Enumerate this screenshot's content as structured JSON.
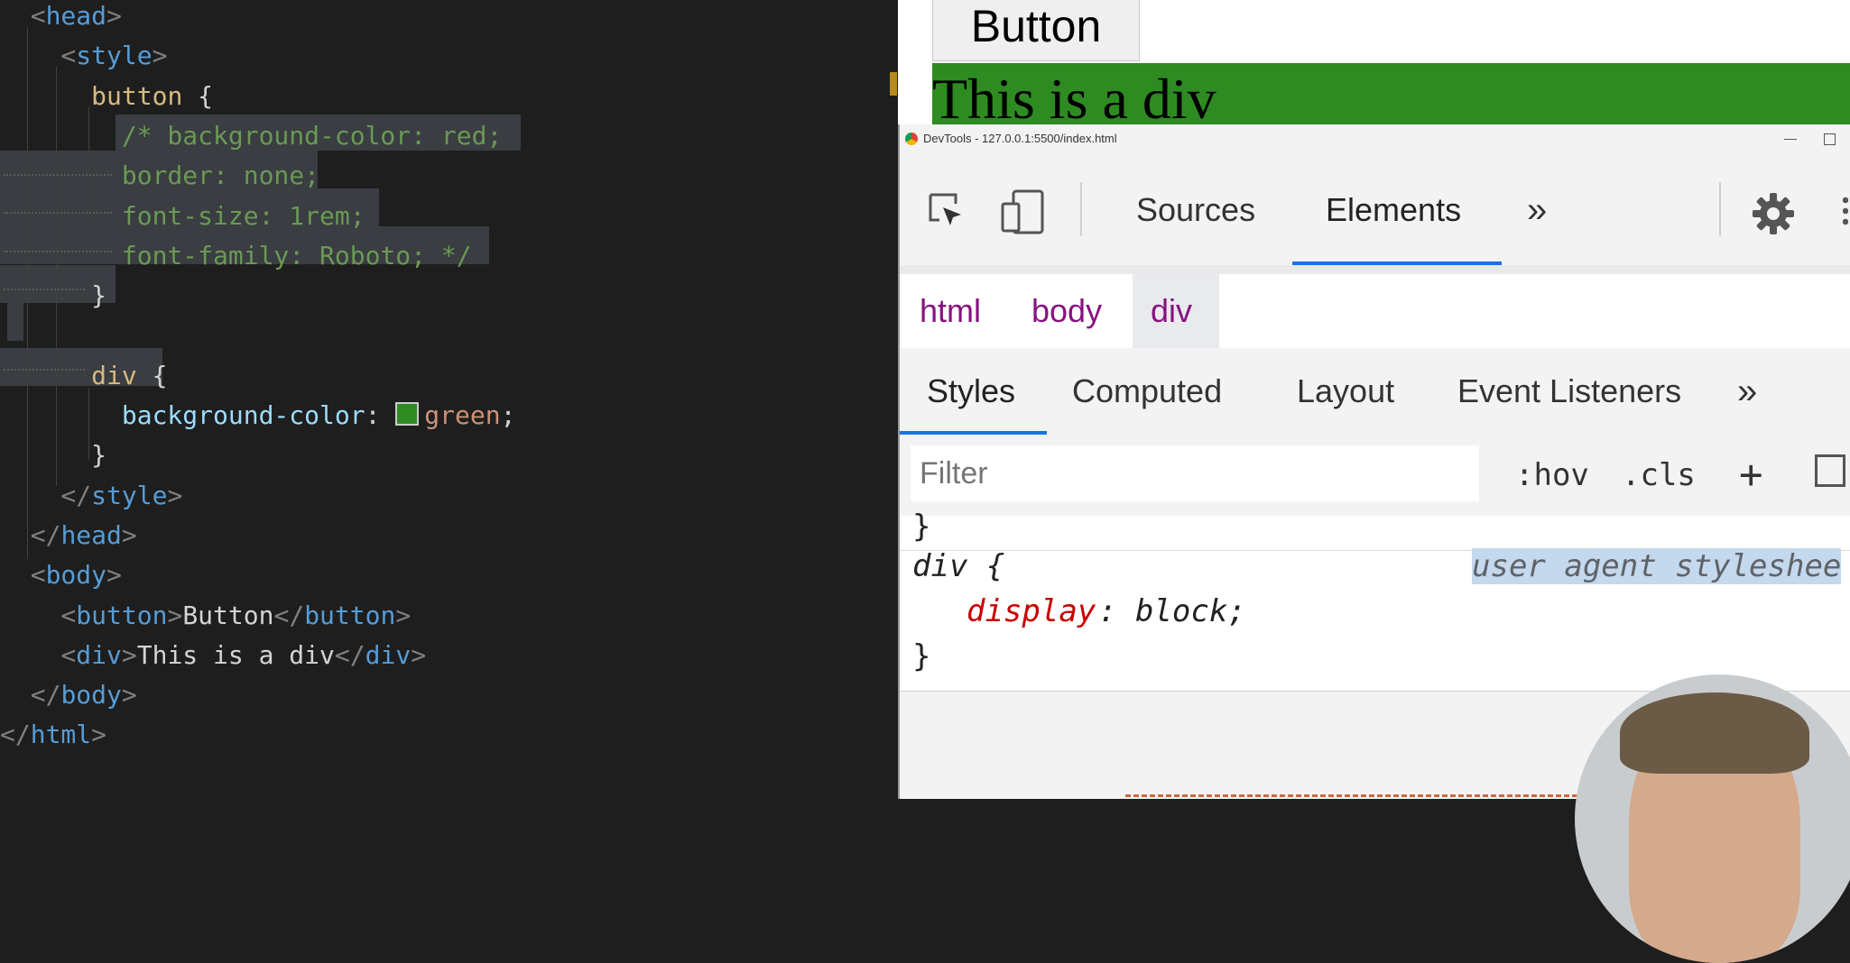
{
  "editor": {
    "lines": [
      [
        {
          "t": "  <",
          "c": "t-br"
        },
        {
          "t": "head",
          "c": "t-tag"
        },
        {
          "t": ">",
          "c": "t-br"
        }
      ],
      [
        {
          "t": "    <",
          "c": "t-br"
        },
        {
          "t": "style",
          "c": "t-tag"
        },
        {
          "t": ">",
          "c": "t-br"
        }
      ],
      [
        {
          "t": "      ",
          "c": "t-txt"
        },
        {
          "t": "button",
          "c": "t-sel"
        },
        {
          "t": " {",
          "c": "t-txt"
        }
      ],
      [
        {
          "t": "        /* background-color: red;",
          "c": "t-cm"
        }
      ],
      [
        {
          "t": "        border: none;",
          "c": "t-cm"
        }
      ],
      [
        {
          "t": "        font-size: 1rem;",
          "c": "t-cm"
        }
      ],
      [
        {
          "t": "        font-family: Roboto; */",
          "c": "t-cm"
        }
      ],
      [
        {
          "t": "      }",
          "c": "t-txt"
        }
      ],
      [
        {
          "t": "",
          "c": "t-txt"
        }
      ],
      [
        {
          "t": "      ",
          "c": "t-txt"
        },
        {
          "t": "div",
          "c": "t-sel"
        },
        {
          "t": " {",
          "c": "t-txt"
        }
      ],
      [
        {
          "t": "        ",
          "c": "t-txt"
        },
        {
          "t": "background-color",
          "c": "t-prop"
        },
        {
          "t": ": ",
          "c": "t-txt"
        },
        {
          "t": "",
          "c": "swatch"
        },
        {
          "t": "green",
          "c": "t-val"
        },
        {
          "t": ";",
          "c": "t-txt"
        }
      ],
      [
        {
          "t": "      }",
          "c": "t-txt"
        }
      ],
      [
        {
          "t": "    </",
          "c": "t-br"
        },
        {
          "t": "style",
          "c": "t-tag"
        },
        {
          "t": ">",
          "c": "t-br"
        }
      ],
      [
        {
          "t": "  </",
          "c": "t-br"
        },
        {
          "t": "head",
          "c": "t-tag"
        },
        {
          "t": ">",
          "c": "t-br"
        }
      ],
      [
        {
          "t": "  <",
          "c": "t-br"
        },
        {
          "t": "body",
          "c": "t-tag"
        },
        {
          "t": ">",
          "c": "t-br"
        }
      ],
      [
        {
          "t": "    <",
          "c": "t-br"
        },
        {
          "t": "button",
          "c": "t-tag"
        },
        {
          "t": ">",
          "c": "t-br"
        },
        {
          "t": "Button",
          "c": "t-txt"
        },
        {
          "t": "</",
          "c": "t-br"
        },
        {
          "t": "button",
          "c": "t-tag"
        },
        {
          "t": ">",
          "c": "t-br"
        }
      ],
      [
        {
          "t": "    <",
          "c": "t-br"
        },
        {
          "t": "div",
          "c": "t-tag"
        },
        {
          "t": ">",
          "c": "t-br"
        },
        {
          "t": "This is a div",
          "c": "t-txt"
        },
        {
          "t": "</",
          "c": "t-br"
        },
        {
          "t": "div",
          "c": "t-tag"
        },
        {
          "t": ">",
          "c": "t-br"
        }
      ],
      [
        {
          "t": "  </",
          "c": "t-br"
        },
        {
          "t": "body",
          "c": "t-tag"
        },
        {
          "t": ">",
          "c": "t-br"
        }
      ],
      [
        {
          "t": "</",
          "c": "t-br"
        },
        {
          "t": "html",
          "c": "t-tag"
        },
        {
          "t": ">",
          "c": "t-br"
        }
      ]
    ]
  },
  "preview": {
    "button_label": "Button",
    "div_text": "This is a div",
    "div_color": "#2e8b22"
  },
  "devtools": {
    "window_title": "DevTools - 127.0.0.1:5500/index.html",
    "tabs": [
      "Sources",
      "Elements"
    ],
    "active_tab": "Elements",
    "more_tabs_icon": "»",
    "settings_icon": "gear-icon",
    "breadcrumbs": [
      "html",
      "body",
      "div"
    ],
    "subtabs": [
      "Styles",
      "Computed",
      "Layout",
      "Event Listeners"
    ],
    "active_subtab": "Styles",
    "filter_placeholder": "Filter",
    "hov_label": ":hov",
    "cls_label": ".cls",
    "plus_label": "+",
    "rule_prev_close": "}",
    "rule_selector": "div {",
    "rule_source": "user agent styleshee",
    "rule_property": "display",
    "rule_value": " block;",
    "rule_close": "}"
  },
  "colors": {
    "accent": "#1a73e8",
    "editor_bg": "#1e1e1e",
    "selection": "#3a3d41"
  }
}
